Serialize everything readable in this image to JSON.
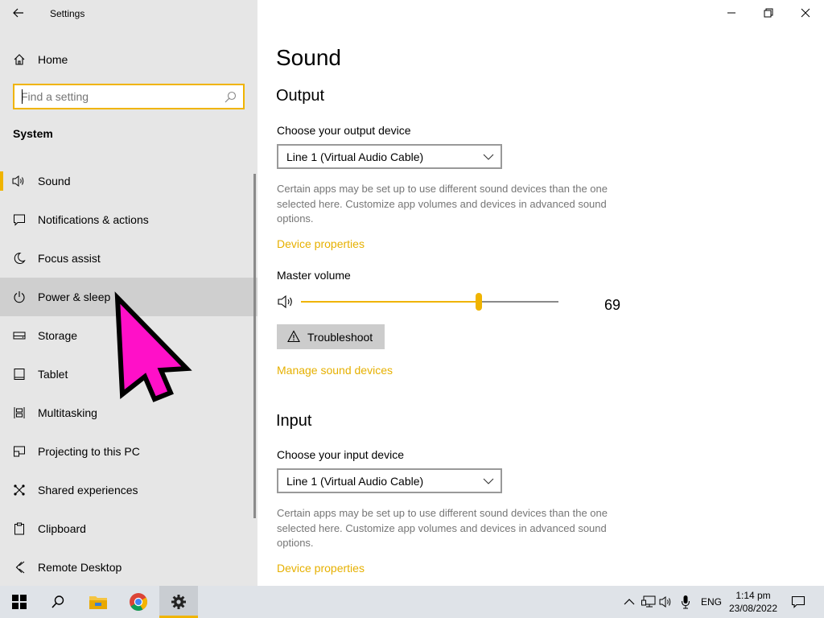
{
  "window": {
    "app_title": "Settings"
  },
  "sidebar": {
    "home_label": "Home",
    "search_placeholder": "Find a setting",
    "section_title": "System",
    "items": [
      {
        "label": "Sound",
        "icon": "speaker-icon",
        "selected": true
      },
      {
        "label": "Notifications & actions",
        "icon": "notification-icon"
      },
      {
        "label": "Focus assist",
        "icon": "moon-icon"
      },
      {
        "label": "Power & sleep",
        "icon": "power-icon",
        "hover": true
      },
      {
        "label": "Storage",
        "icon": "storage-icon"
      },
      {
        "label": "Tablet",
        "icon": "tablet-icon"
      },
      {
        "label": "Multitasking",
        "icon": "multitasking-icon"
      },
      {
        "label": "Projecting to this PC",
        "icon": "projecting-icon"
      },
      {
        "label": "Shared experiences",
        "icon": "shared-icon"
      },
      {
        "label": "Clipboard",
        "icon": "clipboard-icon"
      },
      {
        "label": "Remote Desktop",
        "icon": "remote-desktop-icon"
      }
    ]
  },
  "main": {
    "title": "Sound",
    "output": {
      "heading": "Output",
      "device_label": "Choose your output device",
      "device_value": "Line 1 (Virtual Audio Cable)",
      "description": "Certain apps may be set up to use different sound devices than the one selected here. Customize app volumes and devices in advanced sound options.",
      "device_properties_link": "Device properties",
      "master_volume_label": "Master volume",
      "volume_value": "69",
      "volume_fraction": 0.69,
      "troubleshoot_label": "Troubleshoot",
      "manage_link": "Manage sound devices"
    },
    "input": {
      "heading": "Input",
      "device_label": "Choose your input device",
      "device_value": "Line 1 (Virtual Audio Cable)",
      "description": "Certain apps may be set up to use different sound devices than the one selected here. Customize app volumes and devices in advanced sound options.",
      "device_properties_link": "Device properties"
    }
  },
  "taskbar": {
    "language": "ENG",
    "time": "1:14 pm",
    "date": "23/08/2022"
  },
  "colors": {
    "accent": "#f0b400",
    "link": "#e6b000",
    "cursor": "#ff00cc"
  }
}
